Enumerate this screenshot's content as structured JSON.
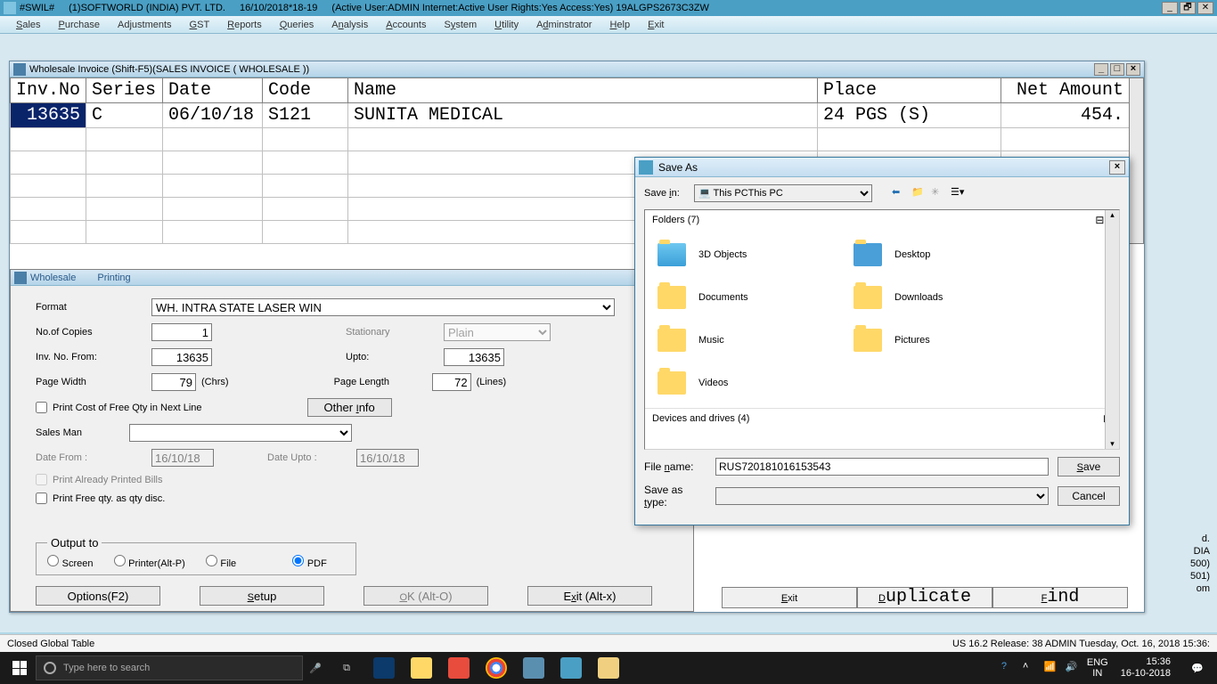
{
  "titlebar": {
    "tag": "#SWIL#",
    "company": "(1)SOFTWORLD (INDIA) PVT. LTD.",
    "period": "16/10/2018*18-19",
    "status": "(Active User:ADMIN Internet:Active  User Rights:Yes Access:Yes) 19ALGPS2673C3ZW"
  },
  "menubar": [
    "Sales",
    "Purchase",
    "Adjustments",
    "GST",
    "Reports",
    "Queries",
    "Analysis",
    "Accounts",
    "System",
    "Utility",
    "Adminstrator",
    "Help",
    "Exit"
  ],
  "invoice_window": {
    "title": "Wholesale Invoice (Shift-F5)(SALES INVOICE ( WHOLESALE ))",
    "headers": [
      "Inv.No",
      "Series",
      "Date",
      "Code",
      "Name",
      "Place",
      "Net Amount"
    ],
    "rows": [
      {
        "inv_no": "13635",
        "series": "C",
        "date": "06/10/18",
        "code": "S121",
        "name": "SUNITA MEDICAL",
        "place": "24 PGS (S)",
        "amount": "454."
      }
    ],
    "bigbuttons": {
      "exit": "Exit",
      "duplicate": "Duplicate",
      "find": "Find"
    }
  },
  "print_panel": {
    "title1": "Wholesale",
    "title2": "Printing",
    "format_label": "Format",
    "format_value": "WH. INTRA STATE LASER WIN",
    "copies_label": "No.of Copies",
    "copies_value": "1",
    "invfrom_label": "Inv. No. From:",
    "invfrom_value": "13635",
    "upto_label": "Upto:",
    "upto_value": "13635",
    "stationary_label": "Stationary",
    "stationary_value": "Plain",
    "pagewidth_label": "Page Width",
    "pagewidth_value": "79",
    "pagewidth_unit": "(Chrs)",
    "pagelength_label": "Page Length",
    "pagelength_value": "72",
    "pagelength_unit": "(Lines)",
    "chk_free_cost": "Print Cost of Free Qty in Next Line",
    "otherinfo": "Other Info",
    "salesman_label": "Sales Man",
    "datefrom_label": "Date From :",
    "datefrom_value": "16/10/18",
    "dateupto_label": "Date Upto :",
    "dateupto_value": "16/10/18",
    "chk_already": "Print Already Printed Bills",
    "chk_freeqty": "Print Free qty. as qty disc.",
    "output_legend": "Output to",
    "out_screen": "Screen",
    "out_printer": "Printer(Alt-P)",
    "out_file": "File",
    "out_pdf": "PDF",
    "btn_options": "Options(F2)",
    "btn_setup": "Setup",
    "btn_ok": "OK (Alt-O)",
    "btn_exit": "Exit (Alt-x)"
  },
  "saveas": {
    "title": "Save As",
    "savein_label": "Save in:",
    "savein_value": "This PC",
    "folders_label": "Folders (7)",
    "folders": [
      "3D Objects",
      "Desktop",
      "Documents",
      "Downloads",
      "Music",
      "Pictures",
      "Videos"
    ],
    "devices_label": "Devices and drives (4)",
    "filename_label": "File name:",
    "filename_value": "RUS720181016153543",
    "savetype_label": "Save as type:",
    "btn_save": "Save",
    "btn_cancel": "Cancel"
  },
  "statusbar": {
    "left": "Closed Global Table",
    "right": "US 16.2 Release: 38  ADMIN  Tuesday, Oct. 16, 2018  15:36:"
  },
  "taskbar": {
    "search_placeholder": "Type here to search",
    "lang1": "ENG",
    "lang2": "IN",
    "time": "15:36",
    "date": "16-10-2018"
  },
  "rightnote": {
    "l1": "d.",
    "l2": "DIA",
    "l3": "500)",
    "l4": "501)",
    "l5": "om"
  }
}
